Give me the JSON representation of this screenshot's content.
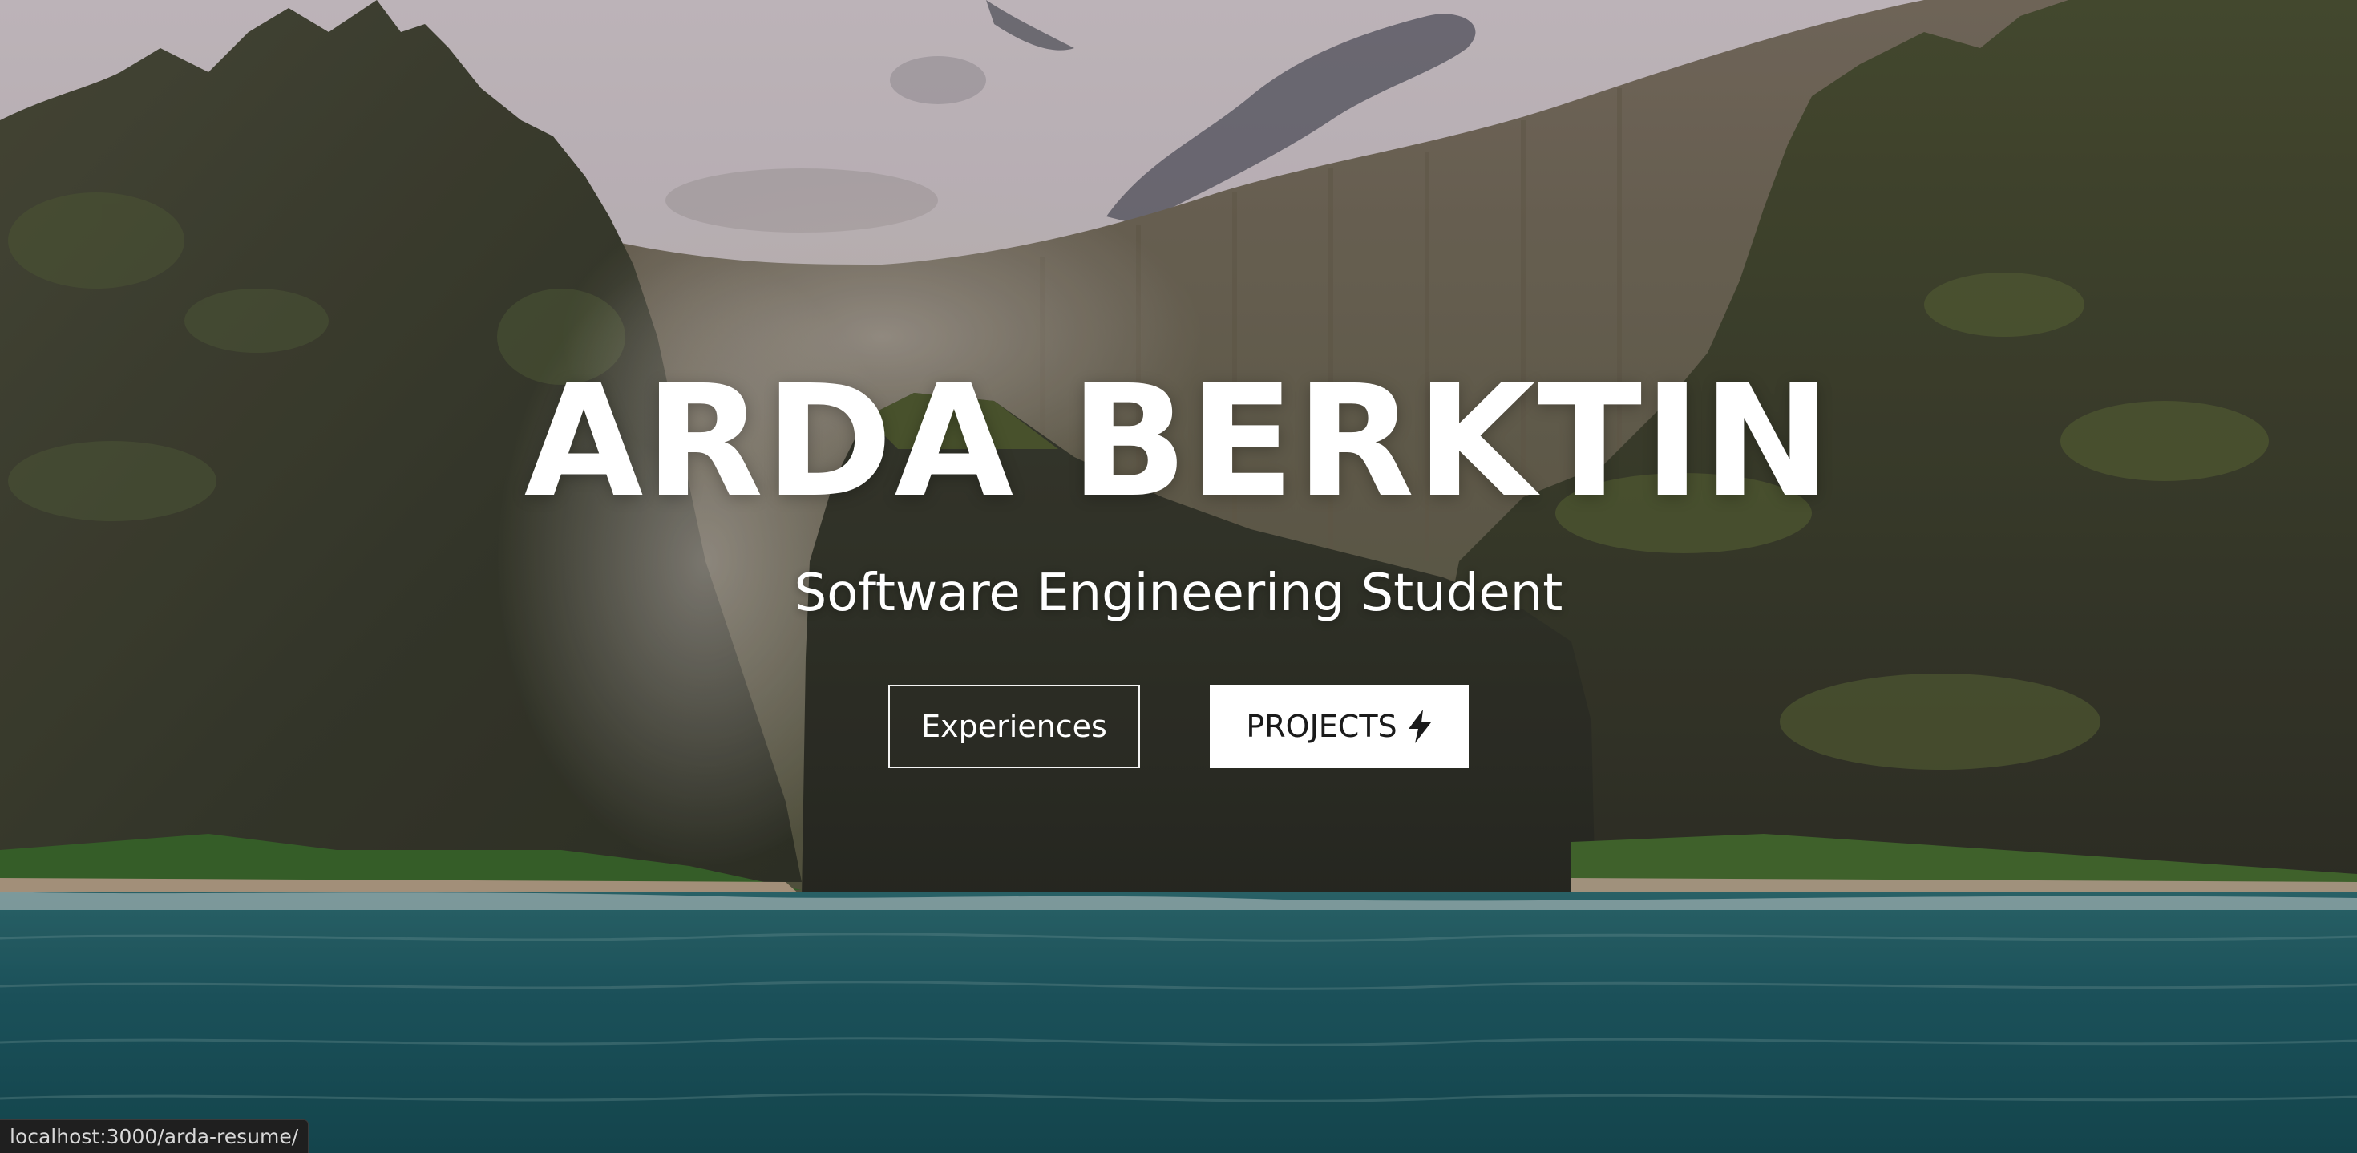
{
  "hero": {
    "name": "ARDA BERKTIN",
    "subtitle": "Software Engineering Student",
    "background_icon": "mountain-coast-photo"
  },
  "actions": {
    "experiences_label": "Experiences",
    "projects_label": "PROJECTS",
    "projects_icon": "lightning-bolt-icon"
  },
  "status_bar": {
    "url": "localhost:3000/arda-resume/"
  },
  "colors": {
    "text_light": "#ffffff",
    "button_fill": "#ffffff",
    "button_text": "#1a1a1a",
    "ocean": "#1c5a63",
    "sky": "#c9bec4"
  }
}
